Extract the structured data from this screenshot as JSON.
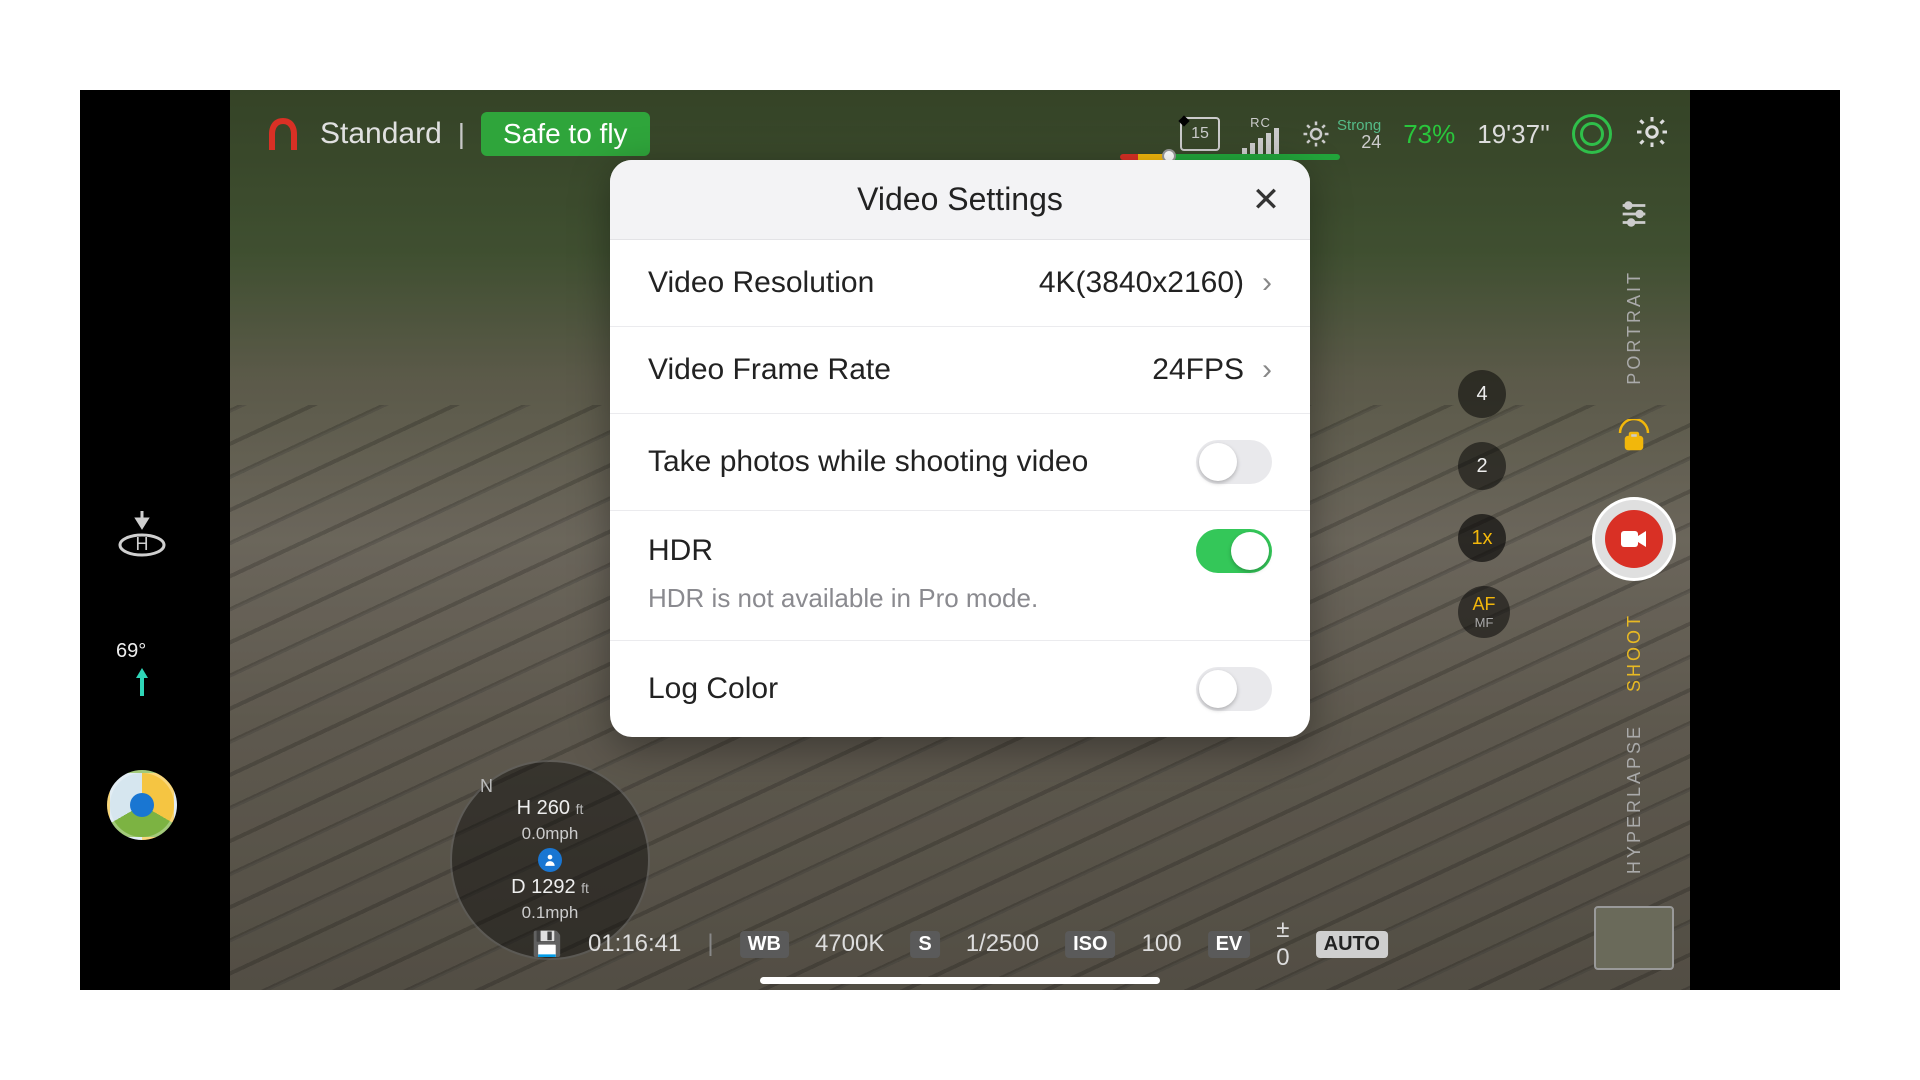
{
  "topbar": {
    "mode": "Standard",
    "status": "Safe to fly",
    "sd_remaining": "15",
    "rc_label": "RC",
    "gps_strength": "Strong",
    "gps_count": "24",
    "battery_pct": "73%",
    "flight_time": "19'37''"
  },
  "left": {
    "gimbal_angle": "69°"
  },
  "radar": {
    "compass": "N",
    "altitude_label": "H 260",
    "altitude_unit": "ft",
    "v_speed": "0.0mph",
    "distance_label": "D 1292",
    "distance_unit": "ft",
    "h_speed": "0.1mph"
  },
  "zoom": {
    "z4": "4",
    "z2": "2",
    "z1": "1x",
    "af": "AF",
    "mf": "MF"
  },
  "right": {
    "portrait": "PORTRAIT",
    "shoot": "SHOOT",
    "hyperlapse": "HYPERLAPSE"
  },
  "bottom": {
    "rec_time": "01:16:41",
    "wb_label": "WB",
    "wb_value": "4700K",
    "s_label": "S",
    "shutter": "1/2500",
    "iso_label": "ISO",
    "iso_value": "100",
    "ev_label": "EV",
    "ev_value": "± 0",
    "auto": "AUTO"
  },
  "modal": {
    "title": "Video Settings",
    "close": "✕",
    "rows": {
      "resolution": {
        "label": "Video Resolution",
        "value": "4K(3840x2160)"
      },
      "framerate": {
        "label": "Video Frame Rate",
        "value": "24FPS"
      },
      "piv": {
        "label": "Take photos while shooting video",
        "on": false
      },
      "hdr": {
        "label": "HDR",
        "note": "HDR is not available in Pro mode.",
        "on": true
      },
      "log": {
        "label": "Log Color",
        "on": false
      }
    }
  }
}
